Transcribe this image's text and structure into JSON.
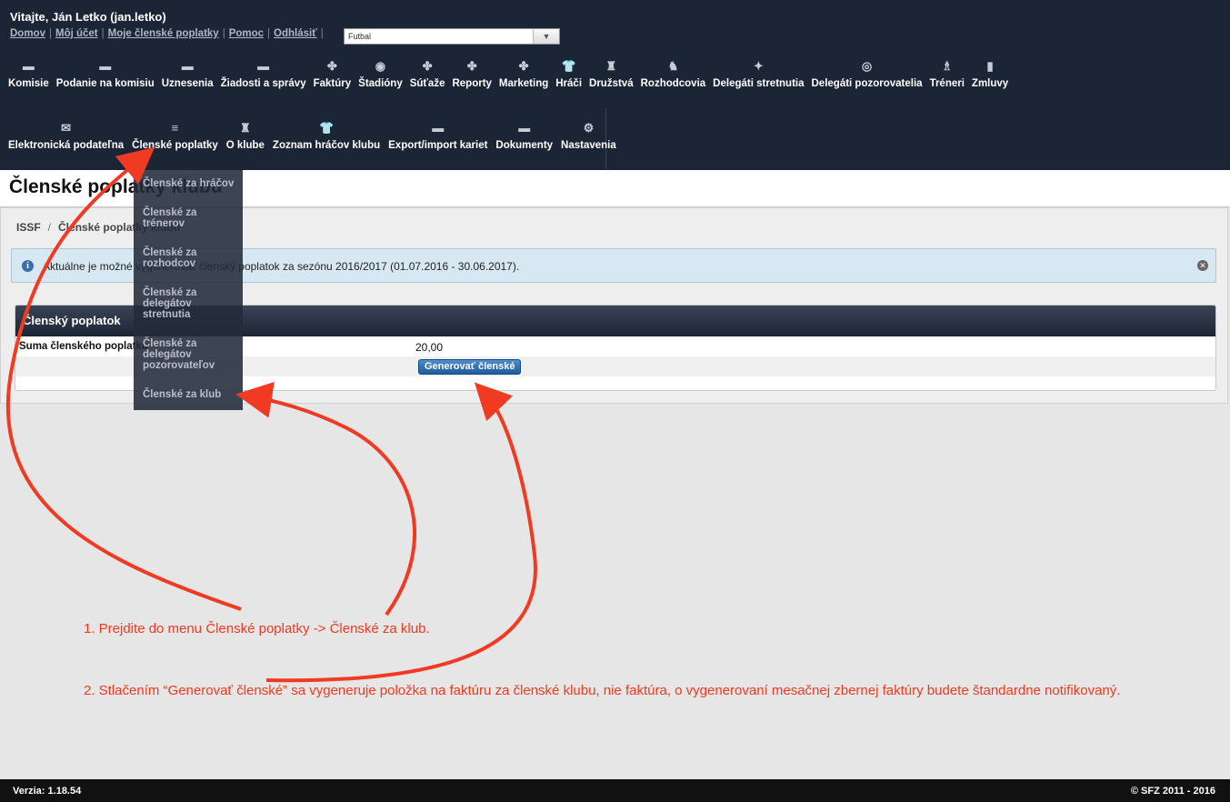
{
  "header": {
    "welcome": "Vitajte, Ján Letko (jan.letko)",
    "links": [
      "Domov",
      "Môj účet",
      "Moje členské poplatky",
      "Pomoc",
      "Odhlásiť"
    ],
    "sport_select": "Futbal"
  },
  "nav_row1": [
    {
      "label": "Komisie",
      "icon": "folder-icon"
    },
    {
      "label": "Podanie na komisiu",
      "icon": "folder-icon"
    },
    {
      "label": "Uznesenia",
      "icon": "folder-icon"
    },
    {
      "label": "Žiadosti a správy",
      "icon": "folder-icon"
    },
    {
      "label": "Faktúry",
      "icon": "puzzle-icon"
    },
    {
      "label": "Štadióny",
      "icon": "stadium-icon"
    },
    {
      "label": "Súťaže",
      "icon": "puzzle-icon"
    },
    {
      "label": "Reporty",
      "icon": "puzzle-icon"
    },
    {
      "label": "Marketing",
      "icon": "puzzle-icon"
    },
    {
      "label": "Hráči",
      "icon": "jersey-icon"
    },
    {
      "label": "Družstvá",
      "icon": "trophy-icon"
    },
    {
      "label": "Rozhodcovia",
      "icon": "referee-icon"
    },
    {
      "label": "Delegáti stretnutia",
      "icon": "runner-icon"
    },
    {
      "label": "Delegáti pozorovatelia",
      "icon": "eye-icon"
    },
    {
      "label": "Tréneri",
      "icon": "coach-icon"
    },
    {
      "label": "Zmluvy",
      "icon": "document-icon"
    }
  ],
  "nav_row2": [
    {
      "label": "Elektronická podateľna",
      "icon": "mail-icon"
    },
    {
      "label": "Členské poplatky",
      "icon": "coins-icon"
    },
    {
      "label": "O klube",
      "icon": "trophy-icon"
    },
    {
      "label": "Zoznam hráčov klubu",
      "icon": "jersey-icon"
    },
    {
      "label": "Export/import kariet",
      "icon": "folder-icon"
    },
    {
      "label": "Dokumenty",
      "icon": "folder-icon"
    },
    {
      "label": "Nastavenia",
      "icon": "gears-icon"
    }
  ],
  "dropdown": [
    "Členské za hráčov",
    "Členské za trénerov",
    "Členské za rozhodcov",
    "Členské za delegátov stretnutia",
    "Členské za delegátov pozorovateľov",
    "Členské za klub"
  ],
  "page": {
    "title": "Členské poplatky klubu",
    "breadcrumb": [
      "ISSF",
      "Členské poplatky klubu"
    ],
    "alert": "Aktuálne je možné vygenerovať členský poplatok za sezónu 2016/2017 (01.07.2016 - 30.06.2017).",
    "panel_title": "Členský poplatok",
    "fee_label": "Suma členského poplatku",
    "fee_value": "20,00",
    "generate_button": "Generovať členské"
  },
  "annotations": {
    "note1": "1. Prejdite do menu Členské poplatky -> Členské za klub.",
    "note2": "2. Stlačením “Generovať členské” sa vygeneruje položka na faktúru za členské klubu, nie faktúra, o vygenerovaní mesačnej zbernej faktúry budete štandardne notifikovaný.",
    "color": "#f03a22"
  },
  "footer": {
    "version": "Verzia: 1.18.54",
    "copyright": "© SFZ 2011 - 2016"
  }
}
